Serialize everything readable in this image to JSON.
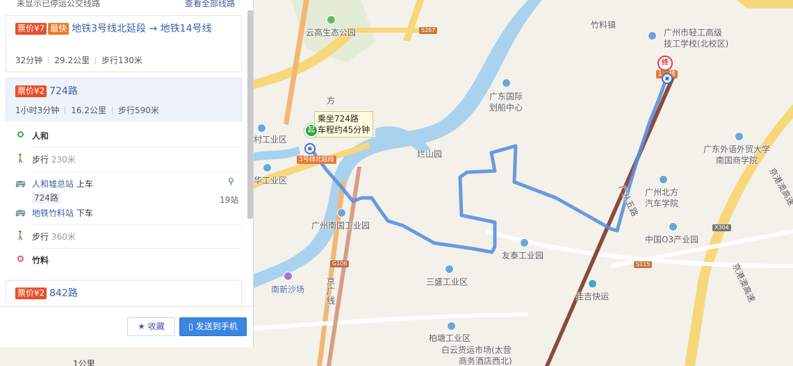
{
  "panel": {
    "top_notice": "未显示已停运公交线路",
    "top_link": "查看全部线路",
    "routes": [
      {
        "price": "票价¥7",
        "badge": "最快",
        "title": "地铁3号线北延段 → 地铁14号线",
        "duration": "32分钟",
        "distance": "29.2公里",
        "walk": "步行130米"
      },
      {
        "price": "票价¥2",
        "title": "724路",
        "duration": "1小时3分钟",
        "distance": "16.2公里",
        "walk": "步行590米",
        "steps": {
          "origin": "人和",
          "walk1_label": "步行",
          "walk1_dist": "230米",
          "board_station": "人和墟总站",
          "board_action": "上车",
          "line_chip": "724路",
          "stops": "19站",
          "alight_station": "地铁竹料站",
          "alight_action": "下车",
          "walk2_label": "步行",
          "walk2_dist": "360米",
          "destination": "竹料"
        }
      },
      {
        "price": "票价¥2",
        "title": "842路"
      }
    ],
    "buttons": {
      "favorite": "收藏",
      "send": "发送到手机"
    }
  },
  "map": {
    "tooltip_line1": "乘坐724路",
    "tooltip_line2": "车程约45分钟",
    "start_marker": "起",
    "end_marker": "终",
    "start_line_tag": "3号线北延段",
    "end_line_tag": "1",
    "end_line_suffix": "线",
    "scale": "1公里",
    "labels": {
      "yungao": "云高生态公园",
      "zhuliao": "竹料镇",
      "qinggong1": "广州市轻工高级",
      "qinggong2": "技工学校(北校区)",
      "huachuan1": "广东国际",
      "huachuan2": "划船中心",
      "fanghuaxian": "方",
      "cun_gy": "村工业区",
      "hua_gy": "华工业区",
      "lanshan": "烂山园",
      "waiyu1": "广东外语外贸大学",
      "waiyu2": "南国商学院",
      "beifang1": "广州北方",
      "beifang2": "汽车学院",
      "nanguo_gy": "广州南国工业园",
      "o3": "中国O3产业园",
      "youtai": "友泰工业园",
      "sansheng": "三盛工业区",
      "nanxin": "南新沙场",
      "jiaji": "佳吉快运",
      "baitang": "柏塘工业区",
      "baiyun1": "白云货运市场(太营",
      "baiyun2": "商务酒店西北)",
      "jinggang1": "京港澳高速",
      "jinggang2": "京港澳高速",
      "jingguang": "京",
      "guang": "广",
      "xian": "线",
      "guangcong": "广从五路"
    },
    "shields": {
      "s267": "S267",
      "g106": "G106",
      "s115": "S115",
      "x304": "X304"
    }
  },
  "colors": {
    "route": "#5b8fe0",
    "accent": "#3a5ea8",
    "price": "#e8502b",
    "fast": "#ef7b2a"
  }
}
